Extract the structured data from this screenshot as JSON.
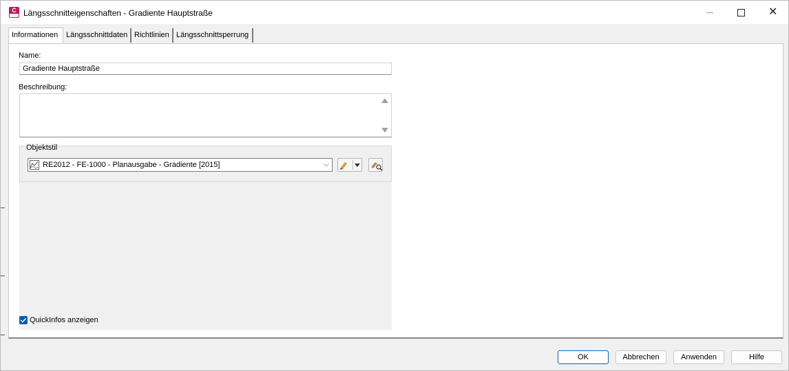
{
  "window": {
    "title": "Längsschnitteigenschaften - Gradiente Hauptstraße",
    "app_icon": "civil3d-app-icon",
    "app_icon_letter": "C"
  },
  "tabs": [
    {
      "label": "Informationen",
      "active": true
    },
    {
      "label": "Längsschnittdaten",
      "active": false
    },
    {
      "label": "Richtlinien",
      "active": false
    },
    {
      "label": "Längsschnittsperrung",
      "active": false
    }
  ],
  "info": {
    "name_label": "Name:",
    "name_value": "Gradiente Hauptstraße",
    "description_label": "Beschreibung:",
    "description_value": "",
    "object_style_group": "Objektstil",
    "object_style_value": "RE2012 - FE-1000 - Planausgabe - Gradiente [2015]",
    "show_tooltips_label": "QuickInfos anzeigen",
    "show_tooltips_checked": true
  },
  "buttons": {
    "ok": "OK",
    "cancel": "Abbrechen",
    "apply": "Anwenden",
    "help": "Hilfe"
  },
  "colors": {
    "accent": "#0067c0",
    "checkbox": "#005fb8",
    "app_icon": "#c2185b"
  }
}
